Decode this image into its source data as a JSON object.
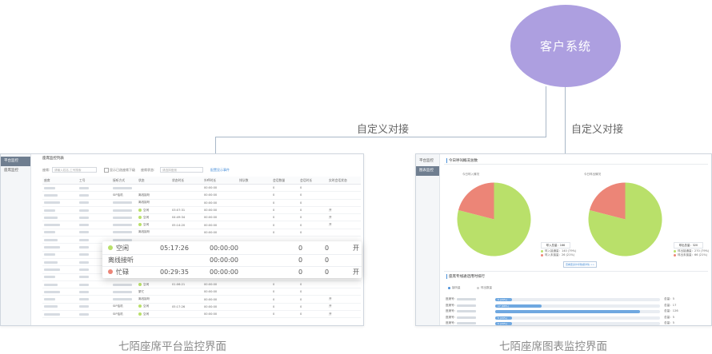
{
  "system": {
    "label": "客户系统",
    "connector_left": "自定义对接",
    "connector_right": "自定义对接"
  },
  "captions": {
    "left": "七陌座席平台监控界面",
    "right": "七陌座席图表监控界面"
  },
  "left_panel": {
    "sidebar": [
      {
        "label": "平台监控",
        "active": true
      },
      {
        "label": "座席监控",
        "active": false
      }
    ],
    "section_title": "座席监控列表",
    "filters": {
      "agent_label": "座席:",
      "agent_placeholder": "请输入姓名,工号搜索",
      "checkbox_label": "显示已选座席下级",
      "status_label": "座席状态:",
      "status_placeholder": "请选择座席",
      "config_link": "配置显示事件"
    },
    "columns": [
      "座席",
      "工号",
      "接听方式",
      "状态",
      "状态时长",
      "外呼时长",
      "排队数",
      "会话数量",
      "会话时长",
      "实时会话状态"
    ],
    "rows": [
      {
        "mode": "",
        "status": "",
        "dot": "",
        "dur": "",
        "call": "00:00:00",
        "q": "0",
        "c": "0",
        "end": ""
      },
      {
        "mode": "SIP话机",
        "status": "离线接听",
        "dot": "",
        "dur": "",
        "call": "00:00:00",
        "q": "0",
        "c": "0",
        "end": ""
      },
      {
        "mode": "",
        "status": "离线接听",
        "dot": "",
        "dur": "",
        "call": "00:00:00",
        "q": "0",
        "c": "0",
        "end": ""
      },
      {
        "mode": "",
        "status": "空闲",
        "dot": "green",
        "dur": "03:07:31",
        "call": "00:00:00",
        "q": "0",
        "c": "0",
        "end": "开"
      },
      {
        "mode": "",
        "status": "空闲",
        "dot": "green",
        "dur": "04:49:34",
        "call": "00:00:00",
        "q": "0",
        "c": "0",
        "end": "开"
      },
      {
        "mode": "",
        "status": "空闲",
        "dot": "green",
        "dur": "05:14:20",
        "call": "00:00:00",
        "q": "0",
        "c": "0",
        "end": "开"
      },
      {
        "mode": "",
        "status": "离线接听",
        "dot": "",
        "dur": "",
        "call": "00:00:00",
        "q": "0",
        "c": "0",
        "end": ""
      },
      {
        "mode": "",
        "status": "",
        "dot": "",
        "dur": "",
        "call": "",
        "q": "",
        "c": "",
        "end": ""
      },
      {
        "mode": "",
        "status": "",
        "dot": "",
        "dur": "",
        "call": "",
        "q": "",
        "c": "",
        "end": ""
      },
      {
        "mode": "",
        "status": "",
        "dot": "",
        "dur": "",
        "call": "",
        "q": "",
        "c": "",
        "end": ""
      },
      {
        "mode": "",
        "status": "",
        "dot": "",
        "dur": "",
        "call": "",
        "q": "",
        "c": "",
        "end": ""
      },
      {
        "mode": "",
        "status": "",
        "dot": "",
        "dur": "",
        "call": "",
        "q": "",
        "c": "",
        "end": ""
      },
      {
        "mode": "",
        "status": "",
        "dot": "",
        "dur": "",
        "call": "00:00:13",
        "q": "0",
        "c": "0",
        "end": ""
      },
      {
        "mode": "",
        "status": "空闲",
        "dot": "green",
        "dur": "01:06:21",
        "call": "00:00:00",
        "q": "0",
        "c": "0",
        "end": ""
      },
      {
        "mode": "",
        "status": "繁忙",
        "dot": "",
        "dur": "",
        "call": "00:00:00",
        "q": "0",
        "c": "0",
        "end": ""
      },
      {
        "mode": "",
        "status": "离线接听",
        "dot": "",
        "dur": "",
        "call": "00:00:00",
        "q": "0",
        "c": "0",
        "end": "开"
      },
      {
        "mode": "SIP话机",
        "status": "空闲",
        "dot": "green",
        "dur": "05:17:26",
        "call": "00:00:00",
        "q": "0",
        "c": "0",
        "end": "开"
      },
      {
        "mode": "SIP话机",
        "status": "空闲",
        "dot": "green",
        "dur": "",
        "call": "00:00:00",
        "q": "0",
        "c": "0",
        "end": "开"
      }
    ],
    "popup": [
      {
        "status": "空闲",
        "dot": "green",
        "dur": "05:17:26",
        "call": "00:00:00",
        "q": "0",
        "c": "0",
        "end": "开"
      },
      {
        "status": "离线接听",
        "dot": "",
        "dur": "",
        "call": "00:00:00",
        "q": "0",
        "c": "0",
        "end": ""
      },
      {
        "status": "忙碌",
        "dot": "red",
        "dur": "00:29:35",
        "call": "00:00:00",
        "q": "0",
        "c": "0",
        "end": "开"
      }
    ]
  },
  "right_panel": {
    "sidebar": [
      {
        "label": "平台监控",
        "active": false
      },
      {
        "label": "图表监控",
        "active": true
      }
    ],
    "section1_title": "今日呼叫概况总数",
    "section2_title": "座席专线通话用时排行",
    "tabs": [
      "接听量",
      "呼出数量"
    ],
    "colors": {
      "green": "#b9e06a",
      "red": "#ec8577",
      "bar": "#6fa8e0",
      "purple": "#ad9fe0"
    },
    "pies": [
      {
        "caption": "今日呼入情况",
        "total_label": "呼入总量：166",
        "legend": [
          "呼入接通量：140 (79%)",
          "呼入未接量：26 (21%)"
        ],
        "chart_data": {
          "type": "pie",
          "values": [
            79,
            21
          ]
        }
      },
      {
        "caption": "今日呼出情况",
        "total_label": "呼出总量：320",
        "legend": [
          "呼出接通量：270 (79%)",
          "呼出未接量：66 (21%)"
        ],
        "chart_data": {
          "type": "pie",
          "values": [
            79,
            21
          ]
        }
      }
    ],
    "view_button": "查看更多外呼数据详情 >>",
    "bars": [
      {
        "label": "座席号：",
        "value_label": "5 (20%)",
        "right": "总量：5",
        "fraction": 0.1
      },
      {
        "label": "座席号：",
        "value_label": "17 (68%)",
        "right": "总量：17",
        "fraction": 0.28
      },
      {
        "label": "座席号：",
        "value_label": "",
        "right": "总量：126",
        "fraction": 0.88
      },
      {
        "label": "座席号：",
        "value_label": "5 (20%)",
        "right": "总量：5",
        "fraction": 0.1
      },
      {
        "label": "座席号：",
        "value_label": "5 (20%)",
        "right": "总量：5",
        "fraction": 0.1
      }
    ]
  }
}
